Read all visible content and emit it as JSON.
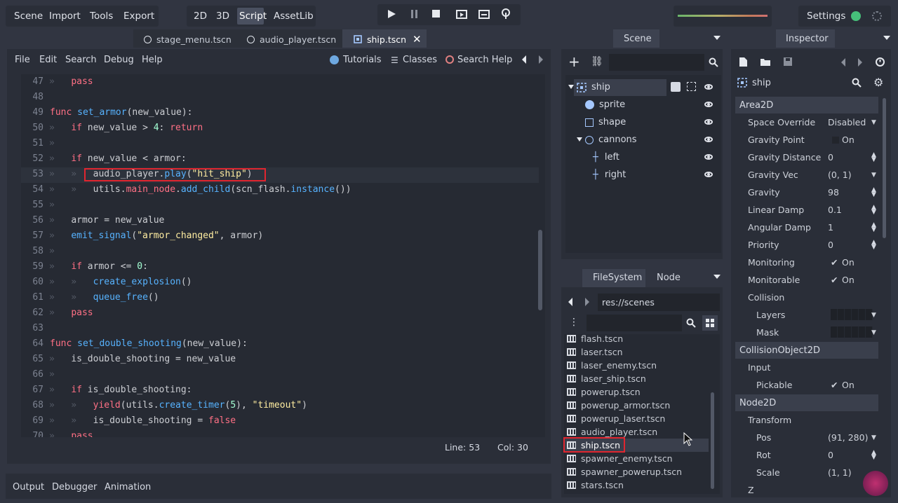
{
  "main_menu": {
    "scene": "Scene",
    "import": "Import",
    "tools": "Tools",
    "export": "Export"
  },
  "workspaces": {
    "twod": "2D",
    "threed": "3D",
    "script": "Script",
    "assetlib": "AssetLib"
  },
  "settings_label": "Settings",
  "scene_tabs": [
    {
      "label": "stage_menu.tscn"
    },
    {
      "label": "audio_player.tscn"
    },
    {
      "label": "ship.tscn"
    }
  ],
  "script_menu": {
    "file": "File",
    "edit": "Edit",
    "search": "Search",
    "debug": "Debug",
    "help": "Help",
    "tutorials": "Tutorials",
    "classes": "Classes",
    "search_help": "Search Help"
  },
  "status": {
    "line": "Line: 53",
    "col": "Col: 30"
  },
  "bottom_tabs": {
    "output": "Output",
    "debugger": "Debugger",
    "animation": "Animation"
  },
  "scene_dock": {
    "title": "Scene",
    "tree": [
      {
        "label": "ship",
        "icon": "area2d-icon"
      },
      {
        "label": "sprite",
        "icon": "sprite-icon"
      },
      {
        "label": "shape",
        "icon": "shape-icon"
      },
      {
        "label": "cannons",
        "icon": "node2d-icon"
      },
      {
        "label": "left",
        "icon": "position2d-icon"
      },
      {
        "label": "right",
        "icon": "position2d-icon"
      }
    ]
  },
  "filesystem": {
    "tab": "FileSystem",
    "node_tab": "Node",
    "path": "res://scenes",
    "files": [
      "flash.tscn",
      "laser.tscn",
      "laser_enemy.tscn",
      "laser_ship.tscn",
      "powerup.tscn",
      "powerup_armor.tscn",
      "powerup_laser.tscn",
      "audio_player.tscn",
      "ship.tscn",
      "spawner_enemy.tscn",
      "spawner_powerup.tscn",
      "stars.tscn"
    ]
  },
  "inspector": {
    "title": "Inspector",
    "object": "ship",
    "sections": {
      "area2d": "Area2D",
      "collisionobject2d": "CollisionObject2D",
      "node2d": "Node2D"
    },
    "props": {
      "space_override": {
        "label": "Space Override",
        "value": "Disabled"
      },
      "gravity_point": {
        "label": "Gravity Point",
        "value": "On"
      },
      "gravity_distance": {
        "label": "Gravity Distance Sc",
        "value": "0"
      },
      "gravity_vec": {
        "label": "Gravity Vec",
        "value": "(0, 1)"
      },
      "gravity": {
        "label": "Gravity",
        "value": "98"
      },
      "linear_damp": {
        "label": "Linear Damp",
        "value": "0.1"
      },
      "angular_damp": {
        "label": "Angular Damp",
        "value": "1"
      },
      "priority": {
        "label": "Priority",
        "value": "0"
      },
      "monitoring": {
        "label": "Monitoring",
        "value": "On"
      },
      "monitorable": {
        "label": "Monitorable",
        "value": "On"
      },
      "collision": {
        "label": "Collision"
      },
      "layers": {
        "label": "Layers"
      },
      "mask": {
        "label": "Mask"
      },
      "input": {
        "label": "Input"
      },
      "pickable": {
        "label": "Pickable",
        "value": "On"
      },
      "transform": {
        "label": "Transform"
      },
      "pos": {
        "label": "Pos",
        "value": "(91, 280)"
      },
      "rot": {
        "label": "Rot",
        "value": "0"
      },
      "scale": {
        "label": "Scale",
        "value": "(1, 1)"
      },
      "z": {
        "label": "Z"
      }
    }
  },
  "code": {
    "l47": "47",
    "l48": "48",
    "l49": "49",
    "l50": "50",
    "l51": "51",
    "l52": "52",
    "l53": "53",
    "l54": "54",
    "l55": "55",
    "l56": "56",
    "l57": "57",
    "l58": "58",
    "l59": "59",
    "l60": "60",
    "l61": "61",
    "l62": "62",
    "l63": "63",
    "l64": "64",
    "l65": "65",
    "l66": "66",
    "l67": "67",
    "l68": "68",
    "l69": "69",
    "l70": "70"
  },
  "colors": {
    "accent": "#57b3ff",
    "keyword": "#ff7085",
    "string": "#ffeda1",
    "number": "#a3ffd4",
    "highlight_box": "#e0252f"
  }
}
